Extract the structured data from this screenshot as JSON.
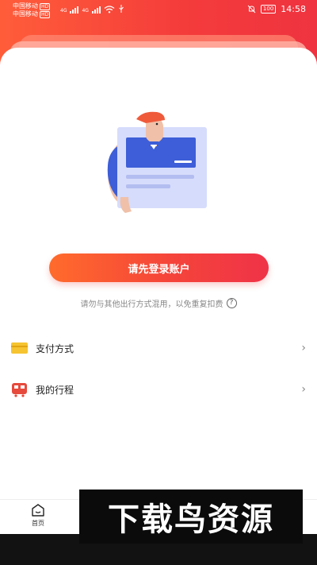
{
  "status_bar": {
    "carrier_1": "中国移动",
    "carrier_2": "中国移动",
    "badge_1": "HD",
    "badge_2": "HD",
    "network_1": "4G",
    "network_2": "4G",
    "battery": "100",
    "time": "14:58"
  },
  "login": {
    "button_label": "请先登录账户",
    "hint": "请勿与其他出行方式混用，以免重复扣费"
  },
  "menu": {
    "items": [
      {
        "label": "支付方式",
        "icon": "card-icon"
      },
      {
        "label": "我的行程",
        "icon": "bus-icon"
      }
    ]
  },
  "bottom_nav": {
    "home_label": "首页"
  },
  "watermark": "下载鸟资源",
  "colors": {
    "accent_start": "#ff6b2c",
    "accent_end": "#ef3348",
    "header_red": "#f43b3b"
  }
}
